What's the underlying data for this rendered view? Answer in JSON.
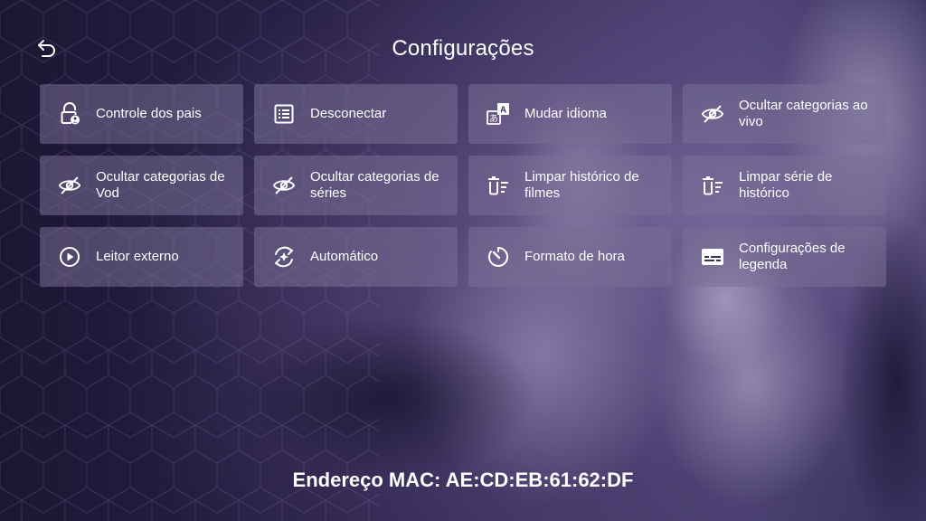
{
  "header": {
    "title": "Configurações",
    "back_icon": "undo-arrow-icon"
  },
  "tiles": [
    {
      "label": "Controle dos pais",
      "icon": "lock-user-icon"
    },
    {
      "label": "Desconectar",
      "icon": "list-icon"
    },
    {
      "label": "Mudar idioma",
      "icon": "translate-icon"
    },
    {
      "label": "Ocultar categorias ao vivo",
      "icon": "eye-off-icon"
    },
    {
      "label": "Ocultar categorias de Vod",
      "icon": "eye-off-icon"
    },
    {
      "label": "Ocultar categorias de séries",
      "icon": "eye-off-icon"
    },
    {
      "label": "Limpar histórico de filmes",
      "icon": "delete-list-icon"
    },
    {
      "label": "Limpar série de histórico",
      "icon": "delete-list-icon"
    },
    {
      "label": "Leitor externo",
      "icon": "play-circle-icon"
    },
    {
      "label": "Automático",
      "icon": "auto-refresh-icon"
    },
    {
      "label": "Formato de hora",
      "icon": "timer-icon"
    },
    {
      "label": "Configurações de legenda",
      "icon": "subtitles-icon"
    }
  ],
  "footer": {
    "mac_text": "Endereço MAC: AE:CD:EB:61:62:DF"
  },
  "colors": {
    "accent_bg": "#2a2148",
    "tile_bg": "#78709680",
    "text": "#ffffff"
  }
}
